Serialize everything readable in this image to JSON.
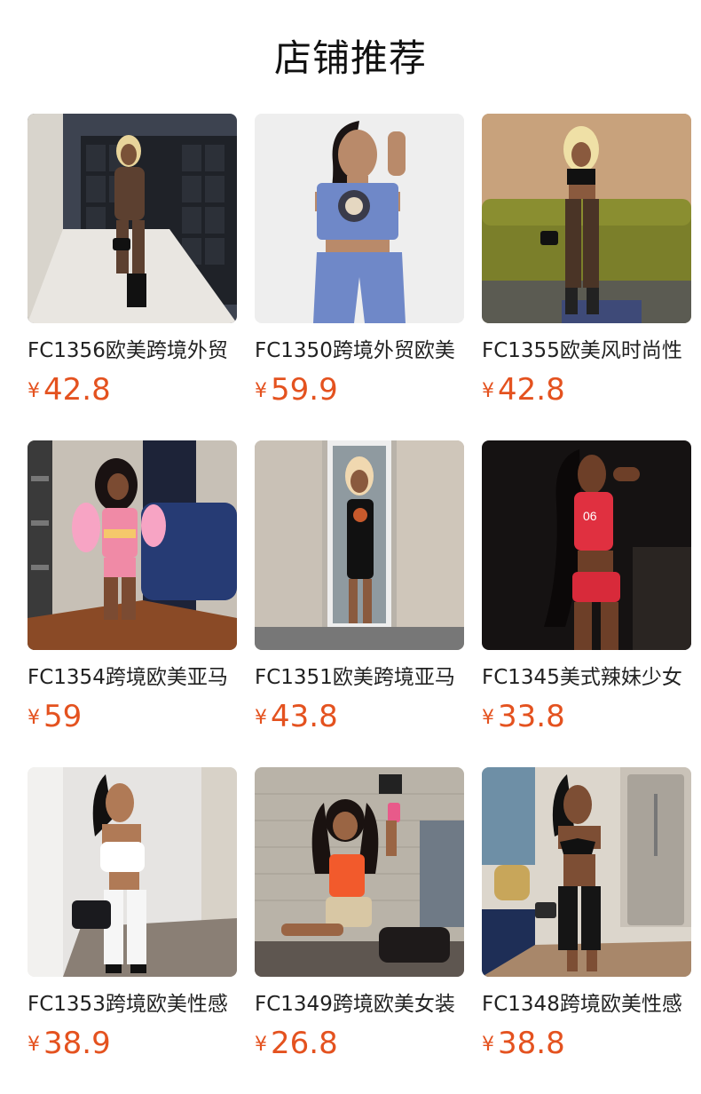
{
  "page": {
    "title": "店铺推荐"
  },
  "products": [
    {
      "name": "FC1356欧美跨境外贸",
      "currency": "¥",
      "price": "42.8",
      "photo": "woman-mesh-outfit-mailroom"
    },
    {
      "name": "FC1350跨境外贸欧美",
      "currency": "¥",
      "price": "59.9",
      "photo": "woman-blue-tube-top-joggers"
    },
    {
      "name": "FC1355欧美风时尚性",
      "currency": "¥",
      "price": "42.8",
      "photo": "woman-mesh-set-green-sofa"
    },
    {
      "name": "FC1354跨境欧美亚马",
      "currency": "¥",
      "price": "59",
      "photo": "woman-pink-print-set-feather-sleeves"
    },
    {
      "name": "FC1351欧美跨境亚马",
      "currency": "¥",
      "price": "43.8",
      "photo": "woman-black-tube-dress-doorway"
    },
    {
      "name": "FC1345美式辣妹少女",
      "currency": "¥",
      "price": "33.8",
      "photo": "woman-red-06-top-shorts"
    },
    {
      "name": "FC1353跨境欧美性感",
      "currency": "¥",
      "price": "38.9",
      "photo": "woman-white-crop-leggings"
    },
    {
      "name": "FC1349跨境欧美女装",
      "currency": "¥",
      "price": "26.8",
      "photo": "woman-orange-tee-selfie"
    },
    {
      "name": "FC1348跨境欧美性感",
      "currency": "¥",
      "price": "38.8",
      "photo": "woman-black-bikini-top-kitchen"
    }
  ],
  "colors": {
    "price": "#e4521f",
    "text": "#222222",
    "background": "#ffffff"
  }
}
